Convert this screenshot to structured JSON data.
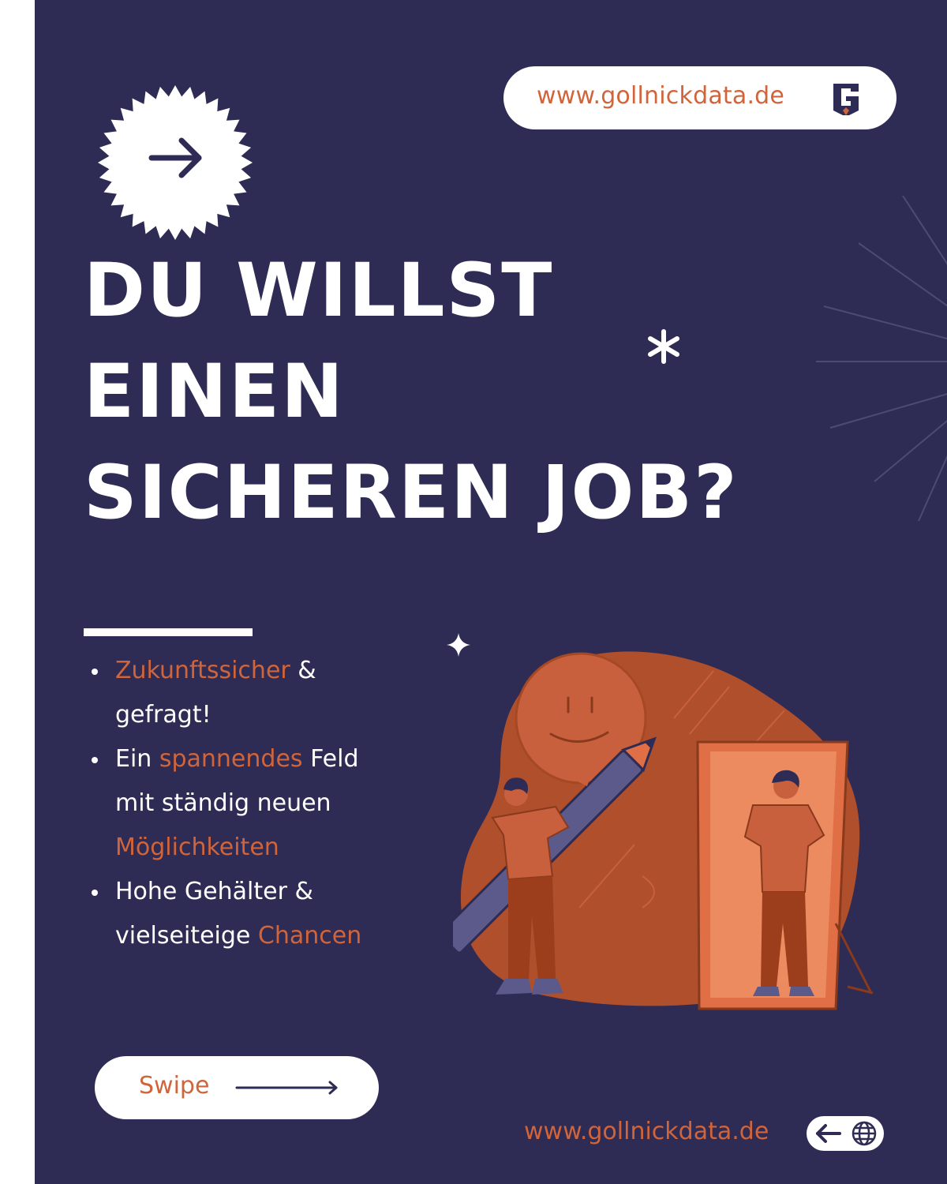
{
  "header": {
    "url": "www.gollnickdata.de",
    "logo_icon": "gollnickdata-logo-icon"
  },
  "badge": {
    "icon": "arrow-right-icon"
  },
  "headline": {
    "lines": [
      "DU WILLST",
      "EINEN",
      "SICHEREN JOB?"
    ]
  },
  "bullets": [
    {
      "parts": [
        {
          "text": "Zukunftssicher",
          "accent": true
        },
        {
          "text": " & gefragt!",
          "accent": false
        }
      ]
    },
    {
      "parts": [
        {
          "text": "Ein ",
          "accent": false
        },
        {
          "text": "spannendes",
          "accent": true
        },
        {
          "text": " Feld mit ständig neuen ",
          "accent": false
        },
        {
          "text": "Möglichkeiten",
          "accent": true
        }
      ]
    },
    {
      "parts": [
        {
          "text": "Hohe Gehälter & vielseiteige ",
          "accent": false
        },
        {
          "text": "Chancen",
          "accent": true
        }
      ]
    }
  ],
  "swipe": {
    "label": "Swipe",
    "icon": "long-arrow-right-icon"
  },
  "footer": {
    "url": "www.gollnickdata.de",
    "icons": [
      "arrow-left-icon",
      "globe-icon"
    ]
  },
  "colors": {
    "background": "#2e2c54",
    "accent": "#d0643b",
    "white": "#ffffff",
    "illustration_dark": "#b04f2c",
    "illustration_mid": "#c8603d",
    "illustration_light": "#e98459"
  }
}
